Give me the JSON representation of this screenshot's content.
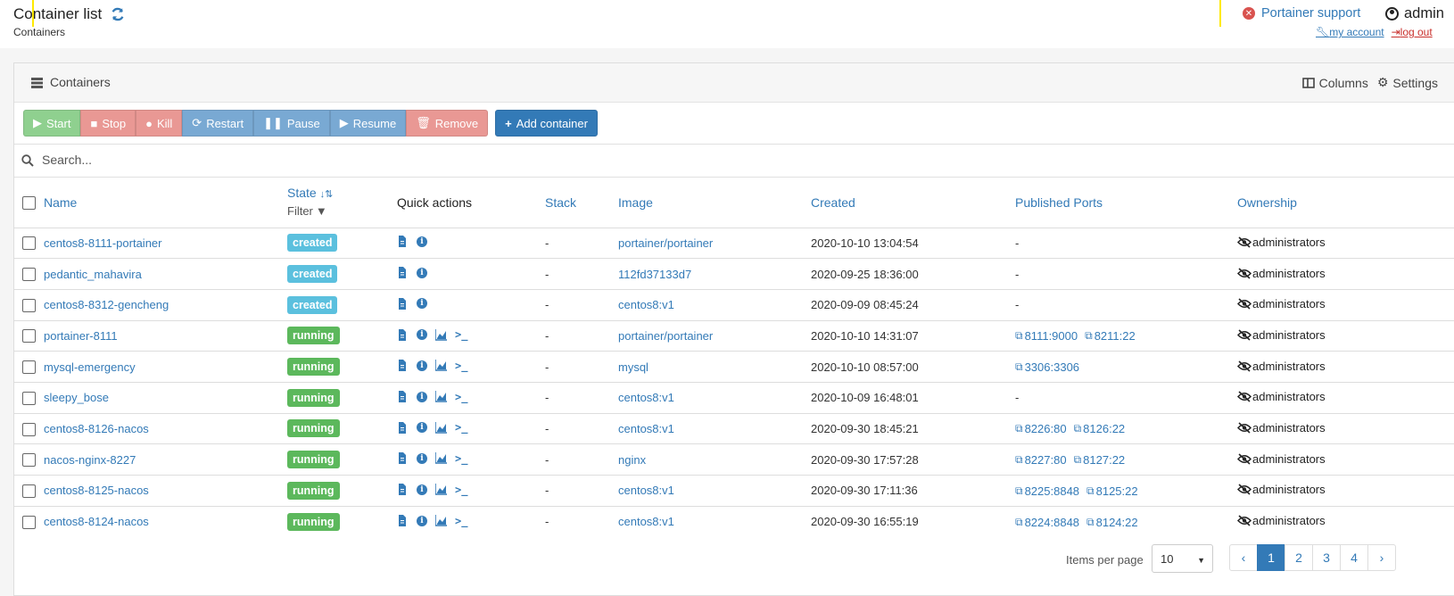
{
  "header": {
    "title": "Container list",
    "breadcrumb": "Containers",
    "support_link": "Portainer support",
    "username": "admin",
    "my_account": "my account",
    "log_out": "log out"
  },
  "panel": {
    "title": "Containers",
    "columns_label": "Columns",
    "settings_label": "Settings"
  },
  "actions": {
    "start": "Start",
    "stop": "Stop",
    "kill": "Kill",
    "restart": "Restart",
    "pause": "Pause",
    "resume": "Resume",
    "remove": "Remove",
    "add": "Add container"
  },
  "search": {
    "placeholder": "Search..."
  },
  "table": {
    "headers": {
      "name": "Name",
      "state": "State",
      "filter": "Filter",
      "quick_actions": "Quick actions",
      "stack": "Stack",
      "image": "Image",
      "created": "Created",
      "ports": "Published Ports",
      "ownership": "Ownership"
    },
    "rows": [
      {
        "name": "centos8-8111-portainer",
        "state": "created",
        "stack": "-",
        "image": "portainer/portainer",
        "created": "2020-10-10 13:04:54",
        "ports": [],
        "ownership": "administrators"
      },
      {
        "name": "pedantic_mahavira",
        "state": "created",
        "stack": "-",
        "image": "112fd37133d7",
        "created": "2020-09-25 18:36:00",
        "ports": [],
        "ownership": "administrators"
      },
      {
        "name": "centos8-8312-gencheng",
        "state": "created",
        "stack": "-",
        "image": "centos8:v1",
        "created": "2020-09-09 08:45:24",
        "ports": [],
        "ownership": "administrators"
      },
      {
        "name": "portainer-8111",
        "state": "running",
        "stack": "-",
        "image": "portainer/portainer",
        "created": "2020-10-10 14:31:07",
        "ports": [
          "8111:9000",
          "8211:22"
        ],
        "ownership": "administrators"
      },
      {
        "name": "mysql-emergency",
        "state": "running",
        "stack": "-",
        "image": "mysql",
        "created": "2020-10-10 08:57:00",
        "ports": [
          "3306:3306"
        ],
        "ownership": "administrators"
      },
      {
        "name": "sleepy_bose",
        "state": "running",
        "stack": "-",
        "image": "centos8:v1",
        "created": "2020-10-09 16:48:01",
        "ports": [],
        "ownership": "administrators"
      },
      {
        "name": "centos8-8126-nacos",
        "state": "running",
        "stack": "-",
        "image": "centos8:v1",
        "created": "2020-09-30 18:45:21",
        "ports": [
          "8226:80",
          "8126:22"
        ],
        "ownership": "administrators"
      },
      {
        "name": "nacos-nginx-8227",
        "state": "running",
        "stack": "-",
        "image": "nginx",
        "created": "2020-09-30 17:57:28",
        "ports": [
          "8227:80",
          "8127:22"
        ],
        "ownership": "administrators"
      },
      {
        "name": "centos8-8125-nacos",
        "state": "running",
        "stack": "-",
        "image": "centos8:v1",
        "created": "2020-09-30 17:11:36",
        "ports": [
          "8225:8848",
          "8125:22"
        ],
        "ownership": "administrators"
      },
      {
        "name": "centos8-8124-nacos",
        "state": "running",
        "stack": "-",
        "image": "centos8:v1",
        "created": "2020-09-30 16:55:19",
        "ports": [
          "8224:8848",
          "8124:22"
        ],
        "ownership": "administrators"
      }
    ],
    "empty_ports": "-"
  },
  "pagination": {
    "items_per_page_label": "Items per page",
    "items_per_page": "10",
    "prev": "‹",
    "next": "›",
    "pages": [
      "1",
      "2",
      "3",
      "4"
    ],
    "active": "1"
  },
  "colors": {
    "primary": "#337ab7",
    "created_badge": "#5bc0de",
    "running_badge": "#5cb85c",
    "danger": "#d9534f"
  }
}
